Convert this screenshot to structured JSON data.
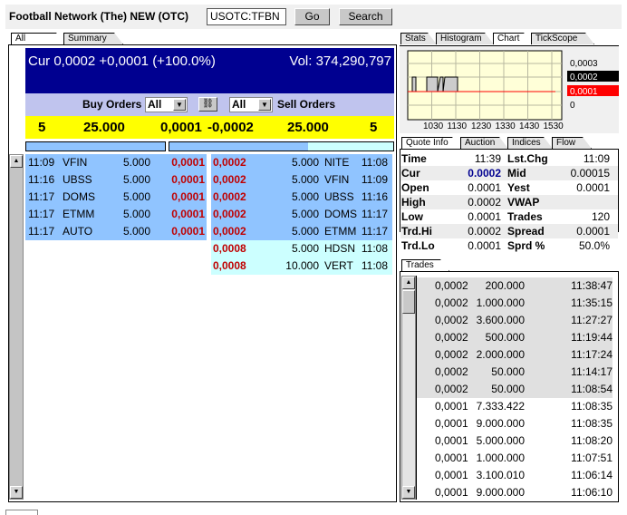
{
  "header": {
    "title": "Football Network (The) NEW (OTC)",
    "symbol": "USOTC:TFBN",
    "go": "Go",
    "search": "Search"
  },
  "left_tabs": [
    "All orders",
    "Summary"
  ],
  "summary": {
    "cur": "Cur 0,0002 +0,0001 (+100.0%)",
    "vol": "Vol: 374,290,797"
  },
  "filters": {
    "buy_label": "Buy Orders",
    "buy_value": "All",
    "sell_value": "All",
    "sell_label": "Sell Orders"
  },
  "totals": {
    "buy_count": "5",
    "buy_qty": "25.000",
    "bid": "0,0001",
    "ask": "-0,0002",
    "sell_qty": "25.000",
    "sell_count": "5"
  },
  "buy_orders": [
    {
      "time": "11:09",
      "mm": "VFIN",
      "qty": "5.000",
      "price": "0,0001"
    },
    {
      "time": "11:16",
      "mm": "UBSS",
      "qty": "5.000",
      "price": "0,0001"
    },
    {
      "time": "11:17",
      "mm": "DOMS",
      "qty": "5.000",
      "price": "0,0001"
    },
    {
      "time": "11:17",
      "mm": "ETMM",
      "qty": "5.000",
      "price": "0,0001"
    },
    {
      "time": "11:17",
      "mm": "AUTO",
      "qty": "5.000",
      "price": "0,0001"
    }
  ],
  "sell_orders": [
    {
      "price": "0,0002",
      "qty": "5.000",
      "mm": "NITE",
      "time": "11:08"
    },
    {
      "price": "0,0002",
      "qty": "5.000",
      "mm": "VFIN",
      "time": "11:09"
    },
    {
      "price": "0,0002",
      "qty": "5.000",
      "mm": "UBSS",
      "time": "11:16"
    },
    {
      "price": "0,0002",
      "qty": "5.000",
      "mm": "DOMS",
      "time": "11:17"
    },
    {
      "price": "0,0002",
      "qty": "5.000",
      "mm": "ETMM",
      "time": "11:17"
    },
    {
      "price": "0,0008",
      "qty": "5.000",
      "mm": "HDSN",
      "time": "11:08"
    },
    {
      "price": "0,0008",
      "qty": "10.000",
      "mm": "VERT",
      "time": "11:08"
    }
  ],
  "chart_tabs": [
    "Stats",
    "Histogram",
    "Chart",
    "TickScope"
  ],
  "chart": {
    "y_labels": [
      "0,0003",
      "0,0002",
      "0,0001",
      "0"
    ],
    "x_labels": [
      "1030",
      "1130",
      "1230",
      "1330",
      "1430",
      "1530"
    ],
    "colors": {
      "bg": "#ffffd8",
      "last": "#000000",
      "bid": "#ff0000"
    }
  },
  "quote_tabs": [
    "Quote Info",
    "Auction",
    "Indices",
    "Flow"
  ],
  "quote": [
    {
      "l1": "Time",
      "v1": "11:39",
      "l2": "Lst.Chg",
      "v2": "11:09"
    },
    {
      "l1": "Cur",
      "v1": "0.0002",
      "l2": "Mid",
      "v2": "0.00015"
    },
    {
      "l1": "Open",
      "v1": "0.0001",
      "l2": "Yest",
      "v2": "0.0001"
    },
    {
      "l1": "High",
      "v1": "0.0002",
      "l2": "VWAP",
      "v2": ""
    },
    {
      "l1": "Low",
      "v1": "0.0001",
      "l2": "Trades",
      "v2": "120"
    },
    {
      "l1": "Trd.Hi",
      "v1": "0.0002",
      "l2": "Spread",
      "v2": "0.0001"
    },
    {
      "l1": "Trd.Lo",
      "v1": "0.0001",
      "l2": "Sprd %",
      "v2": "50.0%"
    }
  ],
  "trades_tab": "Trades",
  "trades": [
    {
      "price": "0,0002",
      "qty": "200.000",
      "time": "11:38:47"
    },
    {
      "price": "0,0002",
      "qty": "1.000.000",
      "time": "11:35:15"
    },
    {
      "price": "0,0002",
      "qty": "3.600.000",
      "time": "11:27:27"
    },
    {
      "price": "0,0002",
      "qty": "500.000",
      "time": "11:19:44"
    },
    {
      "price": "0,0002",
      "qty": "2.000.000",
      "time": "11:17:24"
    },
    {
      "price": "0,0002",
      "qty": "50.000",
      "time": "11:14:17"
    },
    {
      "price": "0,0002",
      "qty": "50.000",
      "time": "11:08:54"
    },
    {
      "price": "0,0001",
      "qty": "7.333.422",
      "time": "11:08:35"
    },
    {
      "price": "0,0001",
      "qty": "9.000.000",
      "time": "11:08:35"
    },
    {
      "price": "0,0001",
      "qty": "5.000.000",
      "time": "11:08:20"
    },
    {
      "price": "0,0001",
      "qty": "1.000.000",
      "time": "11:07:51"
    },
    {
      "price": "0,0001",
      "qty": "3.100.010",
      "time": "11:06:14"
    },
    {
      "price": "0,0001",
      "qty": "9.000.000",
      "time": "11:06:10"
    }
  ]
}
